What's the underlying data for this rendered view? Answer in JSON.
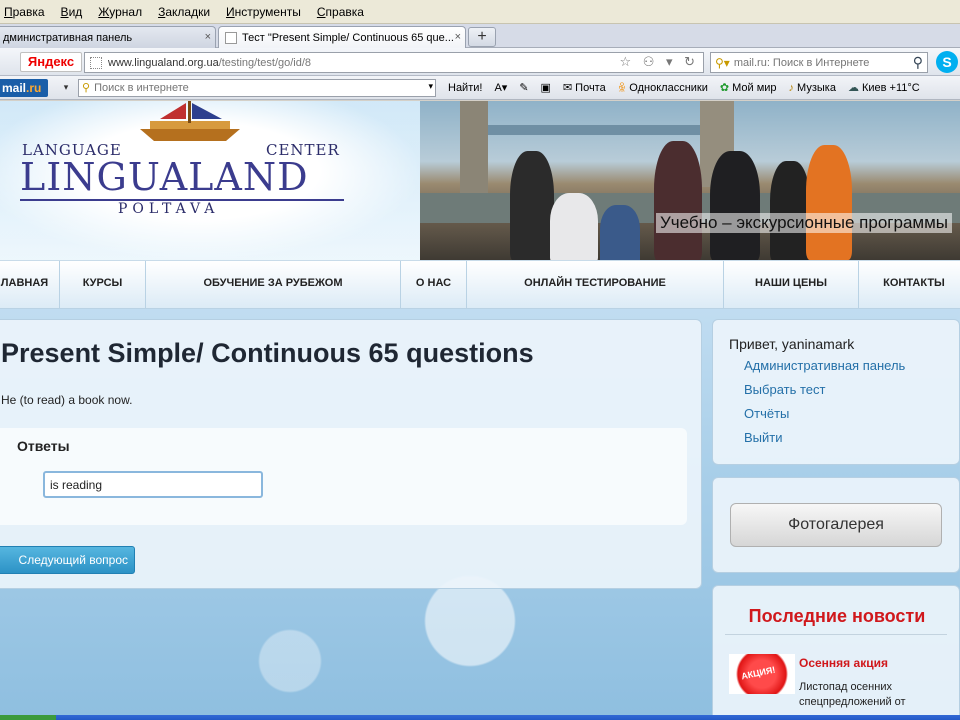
{
  "menu": [
    "Правка",
    "Вид",
    "Журнал",
    "Закладки",
    "Инструменты",
    "Справка"
  ],
  "tabs": [
    {
      "label": "дминистративная панель",
      "close": "×"
    },
    {
      "label": "Тест \"Present Simple/ Continuous 65 que...",
      "close": "×"
    }
  ],
  "new_tab": "+",
  "yandex_label": "Яндекс",
  "url": {
    "host": "www.lingualand.org.ua",
    "path": "/testing/test/go/id/8"
  },
  "search": {
    "placeholder": "mail.ru: Поиск в Интернете"
  },
  "mailbar": {
    "logo": "mail",
    "logo_suffix": ".ru",
    "search_placeholder": "Поиск в интернете",
    "find_label": "Найти!",
    "items": [
      {
        "label": "Почта",
        "icon": "envelope-icon"
      },
      {
        "label": "Одноклассники",
        "icon": "odnoklassniki-icon"
      },
      {
        "label": "Мой мир",
        "icon": "moi-mir-icon"
      },
      {
        "label": "Музыка",
        "icon": "music-icon"
      },
      {
        "label": "Киев +11°C",
        "icon": "weather-icon"
      }
    ]
  },
  "logo": {
    "top_left": "LANGUAGE",
    "top_right": "CENTER",
    "main": "LINGUALAND",
    "city": "POLTAVA"
  },
  "header_caption": "Учебно – экскурсионные программы",
  "nav": [
    "ЛАВНАЯ",
    "КУРСЫ",
    "ОБУЧЕНИЕ ЗА РУБЕЖОМ",
    "О НАС",
    "ОНЛАЙН ТЕСТИРОВАНИЕ",
    "НАШИ ЦЕНЫ",
    "КОНТАКТЫ"
  ],
  "test": {
    "title": "Present Simple/ Continuous 65 questions",
    "question": "He (to read) a book now.",
    "answers_label": "Ответы",
    "answer_value": "is reading",
    "next_label": "Следующий вопрос"
  },
  "user_panel": {
    "greeting": "Привет, yaninamark",
    "links": [
      "Административная панель",
      "Выбрать тест",
      "Отчёты",
      "Выйти"
    ]
  },
  "gallery_label": "Фотогалерея",
  "news": {
    "title": "Последние новости",
    "badge": "АКЦИЯ!",
    "item_title": "Осенняя акция",
    "item_text": "Листопад осенних спецпредложений от"
  },
  "colors": {
    "link": "#2470a8",
    "accent_red": "#d0181c",
    "button_blue": "#2c92c6"
  }
}
